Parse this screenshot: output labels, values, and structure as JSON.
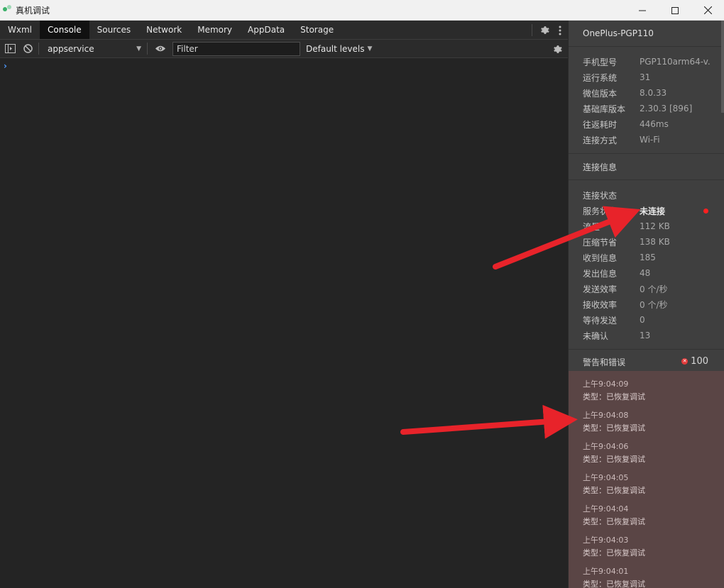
{
  "window": {
    "title": "真机调试",
    "minimize": "—",
    "maximize": "☐",
    "close": "✕"
  },
  "devtools": {
    "tabs": [
      "Wxml",
      "Console",
      "Sources",
      "Network",
      "Memory",
      "AppData",
      "Storage"
    ],
    "active_tab": "Console",
    "toolbar": {
      "context": "appservice",
      "filter_placeholder": "Filter",
      "levels": "Default levels"
    },
    "prompt": "›"
  },
  "panel": {
    "device_name": "OnePlus-PGP110",
    "device_info": [
      {
        "k": "手机型号",
        "v": "PGP110arm64-v..."
      },
      {
        "k": "运行系统",
        "v": "31"
      },
      {
        "k": "微信版本",
        "v": "8.0.33"
      },
      {
        "k": "基础库版本",
        "v": "2.30.3 [896]"
      },
      {
        "k": "往返耗时",
        "v": "446ms"
      },
      {
        "k": "连接方式",
        "v": "Wi-Fi"
      }
    ],
    "connection_info_label": "连接信息",
    "status": [
      {
        "k": "连接状态",
        "v": ""
      },
      {
        "k": "服务状态",
        "v": "未连接"
      },
      {
        "k": "流量",
        "v": "112 KB"
      },
      {
        "k": "压缩节省",
        "v": "138 KB"
      },
      {
        "k": "收到信息",
        "v": "185"
      },
      {
        "k": "发出信息",
        "v": "48"
      },
      {
        "k": "发送效率",
        "v": "0 个/秒"
      },
      {
        "k": "接收效率",
        "v": "0 个/秒"
      },
      {
        "k": "等待发送",
        "v": "0"
      },
      {
        "k": "未确认",
        "v": "13"
      }
    ],
    "warnings_label": "警告和错误",
    "warnings_count": "100",
    "logs": [
      {
        "time": "上午9:04:09",
        "msg": "类型：已恢复调试"
      },
      {
        "time": "上午9:04:08",
        "msg": "类型：已恢复调试"
      },
      {
        "time": "上午9:04:06",
        "msg": "类型：已恢复调试"
      },
      {
        "time": "上午9:04:05",
        "msg": "类型：已恢复调试"
      },
      {
        "time": "上午9:04:04",
        "msg": "类型：已恢复调试"
      },
      {
        "time": "上午9:04:03",
        "msg": "类型：已恢复调试"
      },
      {
        "time": "上午9:04:01",
        "msg": "类型：已恢复调试"
      }
    ]
  },
  "colors": {
    "status_dot": "#ff2020",
    "arrow": "#e8232a",
    "log_bg": "#5a4545"
  }
}
